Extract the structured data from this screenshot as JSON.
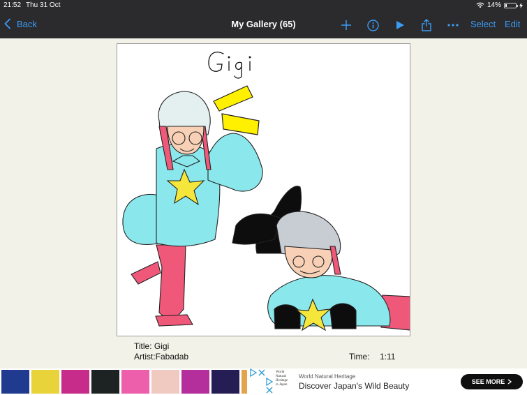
{
  "status": {
    "time": "21:52",
    "date": "Thu 31 Oct",
    "battery": "14%",
    "battery_level": 0.14
  },
  "nav": {
    "back_label": "Back",
    "title": "My Gallery (65)",
    "select_label": "Select",
    "edit_label": "Edit",
    "icons": [
      "wifi-icon",
      "battery-icon",
      "chevron-left-icon",
      "plus-icon",
      "info-icon",
      "play-icon",
      "share-icon",
      "more-icon"
    ],
    "accent": "#3b9cf5"
  },
  "artwork": {
    "handwritten_title": "Gigi",
    "colors": {
      "hair": "#e4f0f0",
      "hair_streak": "#f0587a",
      "sweater": "#8ae8ec",
      "star": "#f4e63a",
      "legs": "#f0587a",
      "black": "#0d0d0d",
      "yellow_mark": "#fff000"
    }
  },
  "info": {
    "title_line": "Title: Gigi",
    "artist_line": "Artist:Fabadab",
    "time_label": "Time:",
    "time_value": "1:11"
  },
  "ad": {
    "swatch_colors": [
      "#1f3a8f",
      "#e9d33b",
      "#c72c8a",
      "#1d2322",
      "#ee5fab",
      "#f0c9c0",
      "#b52f9c",
      "#241e55",
      "#e4a44c"
    ],
    "logo_text": "World Natural Heritage in Japan",
    "small_text": "World Natural Heritage",
    "headline": "Discover Japan's Wild Beauty",
    "cta_label": "SEE MORE"
  }
}
